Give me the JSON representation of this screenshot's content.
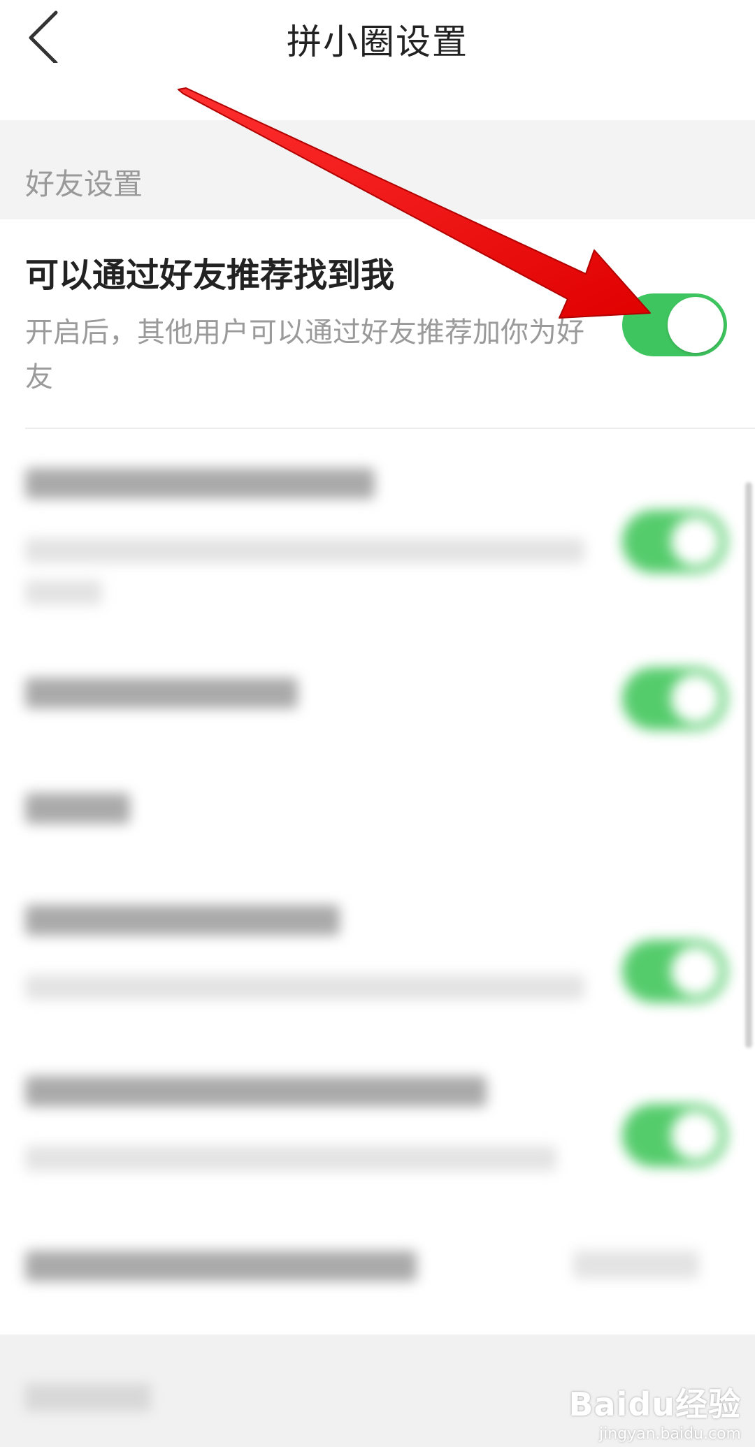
{
  "header": {
    "title": "拼小圈设置",
    "back_icon": "chevron-left-icon"
  },
  "section": {
    "label": "好友设置"
  },
  "setting": {
    "title": "可以通过好友推荐找到我",
    "description": "开启后，其他用户可以通过好友推荐加你为好友",
    "toggle_on": true
  },
  "colors": {
    "toggle_on": "#3fc55f",
    "annotation_arrow": "#ff0000",
    "section_bg": "#f3f3f3"
  },
  "watermark": {
    "text": "Baidu经验",
    "sub": "jingyan.baidu.com"
  }
}
